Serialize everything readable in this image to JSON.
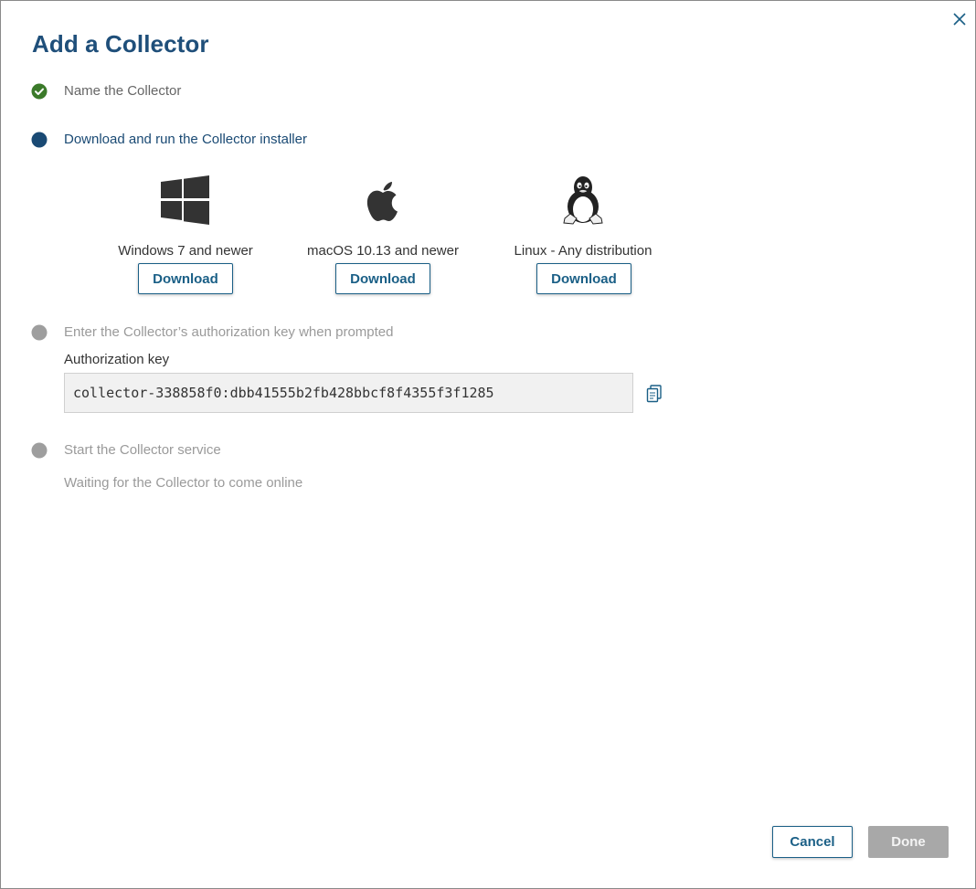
{
  "dialog": {
    "title": "Add a Collector",
    "close_icon": "close-icon"
  },
  "steps": [
    {
      "label": "Name the Collector",
      "status": "completed"
    },
    {
      "label": "Download and run the Collector installer",
      "status": "active"
    },
    {
      "label": "Enter the Collector’s authorization key when prompted",
      "status": "pending"
    },
    {
      "label": "Start the Collector service",
      "status": "pending"
    }
  ],
  "downloads": [
    {
      "os": "Windows 7 and newer",
      "icon": "windows-logo-icon",
      "button": "Download"
    },
    {
      "os": "macOS 10.13 and newer",
      "icon": "apple-logo-icon",
      "button": "Download"
    },
    {
      "os": "Linux - Any distribution",
      "icon": "linux-tux-icon",
      "button": "Download"
    }
  ],
  "authorization": {
    "label": "Authorization key",
    "key": "collector-338858f0:dbb41555b2fb428bbcf8f4355f3f1285",
    "copy_icon": "copy-icon"
  },
  "status_text": "Waiting for the Collector to come online",
  "footer": {
    "cancel_label": "Cancel",
    "done_label": "Done",
    "done_enabled": false
  },
  "colors": {
    "title": "#1f4f7a",
    "accent": "#1a5f86",
    "completed": "#3b7a2a",
    "active": "#1a4a74",
    "pending": "#9e9e9e"
  }
}
